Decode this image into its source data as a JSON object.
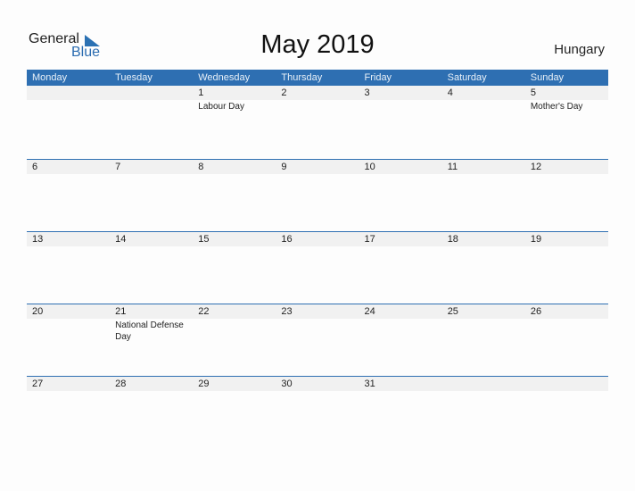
{
  "logo": {
    "word1": "General",
    "word2": "Blue"
  },
  "title": "May 2019",
  "country": "Hungary",
  "colors": {
    "accent": "#2e6fb2",
    "day_bar": "#f1f1f1"
  },
  "weekdays": [
    "Monday",
    "Tuesday",
    "Wednesday",
    "Thursday",
    "Friday",
    "Saturday",
    "Sunday"
  ],
  "weeks": [
    [
      {
        "day": "",
        "event": ""
      },
      {
        "day": "",
        "event": ""
      },
      {
        "day": "1",
        "event": "Labour Day"
      },
      {
        "day": "2",
        "event": ""
      },
      {
        "day": "3",
        "event": ""
      },
      {
        "day": "4",
        "event": ""
      },
      {
        "day": "5",
        "event": "Mother's Day"
      }
    ],
    [
      {
        "day": "6",
        "event": ""
      },
      {
        "day": "7",
        "event": ""
      },
      {
        "day": "8",
        "event": ""
      },
      {
        "day": "9",
        "event": ""
      },
      {
        "day": "10",
        "event": ""
      },
      {
        "day": "11",
        "event": ""
      },
      {
        "day": "12",
        "event": ""
      }
    ],
    [
      {
        "day": "13",
        "event": ""
      },
      {
        "day": "14",
        "event": ""
      },
      {
        "day": "15",
        "event": ""
      },
      {
        "day": "16",
        "event": ""
      },
      {
        "day": "17",
        "event": ""
      },
      {
        "day": "18",
        "event": ""
      },
      {
        "day": "19",
        "event": ""
      }
    ],
    [
      {
        "day": "20",
        "event": ""
      },
      {
        "day": "21",
        "event": "National Defense Day"
      },
      {
        "day": "22",
        "event": ""
      },
      {
        "day": "23",
        "event": ""
      },
      {
        "day": "24",
        "event": ""
      },
      {
        "day": "25",
        "event": ""
      },
      {
        "day": "26",
        "event": ""
      }
    ],
    [
      {
        "day": "27",
        "event": ""
      },
      {
        "day": "28",
        "event": ""
      },
      {
        "day": "29",
        "event": ""
      },
      {
        "day": "30",
        "event": ""
      },
      {
        "day": "31",
        "event": ""
      },
      {
        "day": "",
        "event": ""
      },
      {
        "day": "",
        "event": ""
      }
    ]
  ]
}
